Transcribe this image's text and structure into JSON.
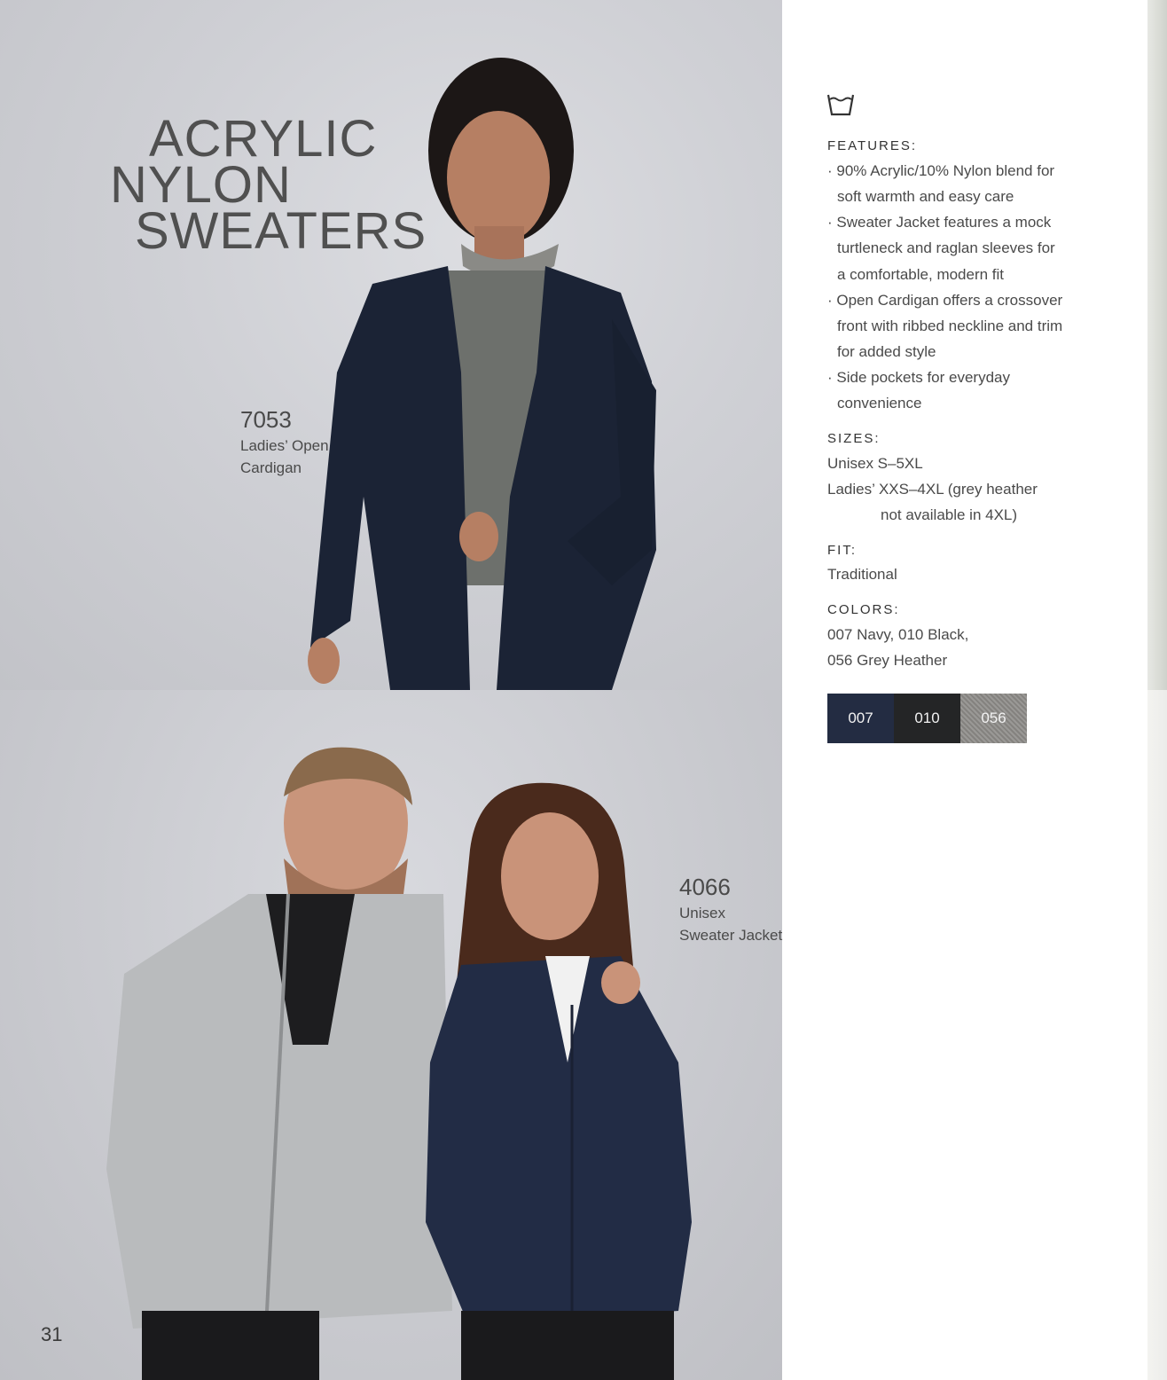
{
  "title": {
    "line1": "ACRYLIC",
    "line2": "NYLON",
    "line3": "SWEATERS"
  },
  "products": [
    {
      "number": "7053",
      "name_line1": "Ladies’ Open",
      "name_line2": "Cardigan"
    },
    {
      "number": "4066",
      "name_line1": "Unisex",
      "name_line2": "Sweater Jacket"
    }
  ],
  "page_number": "31",
  "care_icon": "wash-basin-icon",
  "features": {
    "heading": "FEATURES:",
    "lines": [
      "· 90% Acrylic/10% Nylon blend for",
      "soft warmth and easy care",
      "· Sweater Jacket features a mock",
      "turtleneck and raglan sleeves for",
      "a comfortable, modern fit",
      "· Open Cardigan offers a crossover",
      "front with ribbed neckline and trim",
      "for added style",
      "· Side pockets for everyday",
      "convenience"
    ]
  },
  "sizes": {
    "heading": "SIZES:",
    "line1": "Unisex S–5XL",
    "line2": "Ladies’ XXS–4XL (grey heather",
    "line3": "not available in 4XL)"
  },
  "fit": {
    "heading": "FIT:",
    "value": "Traditional"
  },
  "colors": {
    "heading": "COLORS:",
    "line1": "007 Navy, 010 Black,",
    "line2": "056 Grey Heather",
    "swatches": [
      {
        "code": "007",
        "hex": "#232c42"
      },
      {
        "code": "010",
        "hex": "#242526"
      },
      {
        "code": "056",
        "hex": "#8f8d8a"
      }
    ]
  }
}
